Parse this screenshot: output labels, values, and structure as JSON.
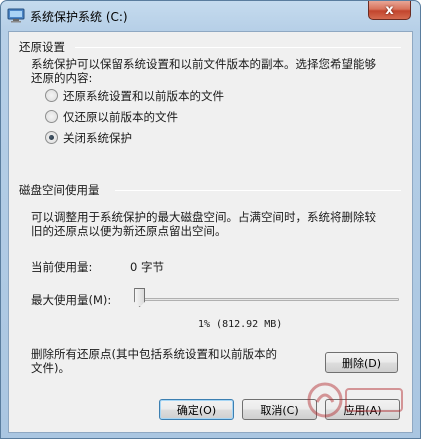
{
  "window": {
    "title": "系统保护系统 (C:)",
    "close_symbol": "x",
    "accent": "#c2452d"
  },
  "restore": {
    "group_title": "还原设置",
    "description_line1": "系统保护可以保留系统设置和以前文件版本的副本。选择您希望能够",
    "description_line2": "还原的内容:",
    "options": [
      {
        "label": "还原系统设置和以前版本的文件",
        "checked": false
      },
      {
        "label": "仅还原以前版本的文件",
        "checked": false
      },
      {
        "label": "关闭系统保护",
        "checked": true
      }
    ]
  },
  "disk": {
    "group_title": "磁盘空间使用量",
    "description_line1": "可以调整用于系统保护的最大磁盘空间。占满空间时，系统将删除较",
    "description_line2": "旧的还原点以便为新还原点留出空间。",
    "current_label": "当前使用量:",
    "current_value": "0 字节",
    "max_label": "最大使用量(M):",
    "slider_percent": 1,
    "slider_text": "1% (812.92 MB)"
  },
  "delete": {
    "description_line1": "删除所有还原点(其中包括系统设置和以前版本的",
    "description_line2": "文件)。",
    "button_label": "删除(D)"
  },
  "footer": {
    "ok_label": "确定(O)",
    "cancel_label": "取消(C)",
    "apply_label": "应用(A)"
  }
}
